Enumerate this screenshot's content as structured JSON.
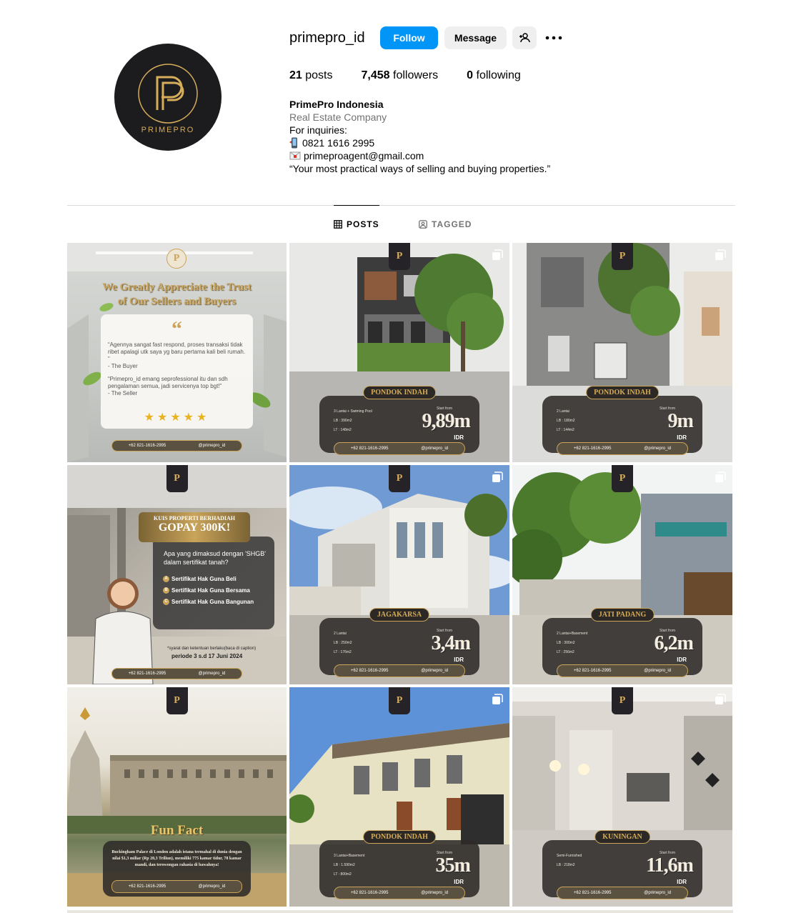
{
  "profile": {
    "username": "primepro_id",
    "avatar_text": "PRIMEPRO",
    "follow_label": "Follow",
    "message_label": "Message",
    "posts_count": "21",
    "posts_label": "posts",
    "followers_count": "7,458",
    "followers_label": "followers",
    "following_count": "0",
    "following_label": "following",
    "full_name": "PrimePro Indonesia",
    "category": "Real Estate Company",
    "bio_line1": "For inquiries:",
    "phone": "0821 1616 2995",
    "email": "primeproagent@gmail.com",
    "tagline": "“Your most practical ways of selling and buying properties.”"
  },
  "tabs": {
    "posts": "POSTS",
    "tagged": "TAGGED"
  },
  "colors": {
    "accent": "#0095f6",
    "gold": "#d6ad5a",
    "dark": "#1c1b1d"
  },
  "icons": [
    "add-user-icon",
    "more-icon",
    "grid-icon",
    "tagged-icon",
    "phone-icon",
    "mail-icon",
    "multi-post-icon",
    "whatsapp-icon",
    "instagram-icon"
  ],
  "posts": {
    "testimonial": {
      "heading1": "We Greatly Appreciate the Trust",
      "heading2": "of Our Sellers and Buyers",
      "quote1": "“Agennya sangat fast respond, proses transaksi tidak ribet apalagi utk saya yg baru pertama kali beli rumah. ”",
      "author1": "- The Buyer",
      "quote2": "“Primepro_id emang seprofessional itu dan sdh pengalaman semua, jadi servicenya top bgt!”",
      "author2": "- The Seller",
      "stars": "★★★★★",
      "phone": "+62 821-1616-2995",
      "ig": "@primepro_id"
    },
    "house1": {
      "location": "PONDOK INDAH",
      "specs": [
        "3 Lantai + Swiming Pool",
        "LB : 390m2",
        "LT : 148m2"
      ],
      "price_from": "Start from",
      "price": "9,89m",
      "currency": "IDR",
      "phone": "+62 821-1616-2995",
      "ig": "@primepro_id"
    },
    "house2": {
      "location": "PONDOK INDAH",
      "specs": [
        "2 Lantai",
        "LB : 180m2",
        "LT : 144m2"
      ],
      "price_from": "Start from",
      "price": "9m",
      "currency": "IDR",
      "phone": "+62 821-1616-2995",
      "ig": "@primepro_id"
    },
    "quiz": {
      "badge_small": "KUIS PROPERTI BERHADIAH",
      "badge_big": "GOPAY 300K!",
      "question": "Apa yang dimaksud dengan 'SHGB' dalam sertifikat tanah?",
      "options": [
        {
          "key": "A",
          "text": "Sertifikat Hak Guna Beli"
        },
        {
          "key": "B",
          "text": "Sertifikat Hak Guna Bersama"
        },
        {
          "key": "C",
          "text": "Sertifikat Hak Guna Bangunan"
        }
      ],
      "note": "*syarat dan ketentuan berlaku(baca di caption)",
      "period": "periode 3 s.d 17 Juni 2024",
      "phone": "+62 821-1616-2995",
      "ig": "@primepro_id"
    },
    "house3": {
      "location": "JAGAKARSA",
      "specs": [
        "2 Lantai",
        "LB : 250m2",
        "LT : 176m2"
      ],
      "price_from": "Start from",
      "price": "3,4m",
      "currency": "IDR",
      "phone": "+62 821-1616-2995",
      "ig": "@primepro_id"
    },
    "house4": {
      "location": "JATI PADANG",
      "specs": [
        "2 Lantai+Basement",
        "LB : 300m2",
        "LT : 256m2"
      ],
      "price_from": "Start from",
      "price": "6,2m",
      "currency": "IDR",
      "phone": "+62 821-1616-2995",
      "ig": "@primepro_id"
    },
    "funfact": {
      "title": "Fun Fact",
      "text": "Buckingham Palace di London adalah istana termahal di dunia dengan nilai $1,3 miliar (Rp 20,3 Triliun), memiliki 775 kamar tidur, 78 kamar mandi, dan terowongan rahasia di bawahnya!",
      "phone": "+62 821-1616-2995",
      "ig": "@primepro_id"
    },
    "house5": {
      "location": "PONDOK INDAH",
      "specs": [
        "3 Lantai+Basement",
        "LB : 1.590m2",
        "LT : 800m2"
      ],
      "price_from": "Start from",
      "price": "35m",
      "currency": "IDR",
      "phone": "+62 821-1616-2995",
      "ig": "@primepro_id"
    },
    "house6": {
      "location": "KUNINGAN",
      "specs": [
        "Semi-Furnished",
        "LB : 218m2"
      ],
      "price_from": "Start from",
      "price": "11,6m",
      "currency": "IDR",
      "phone": "+62 821-1616-2995",
      "ig": "@primepro_id"
    }
  }
}
